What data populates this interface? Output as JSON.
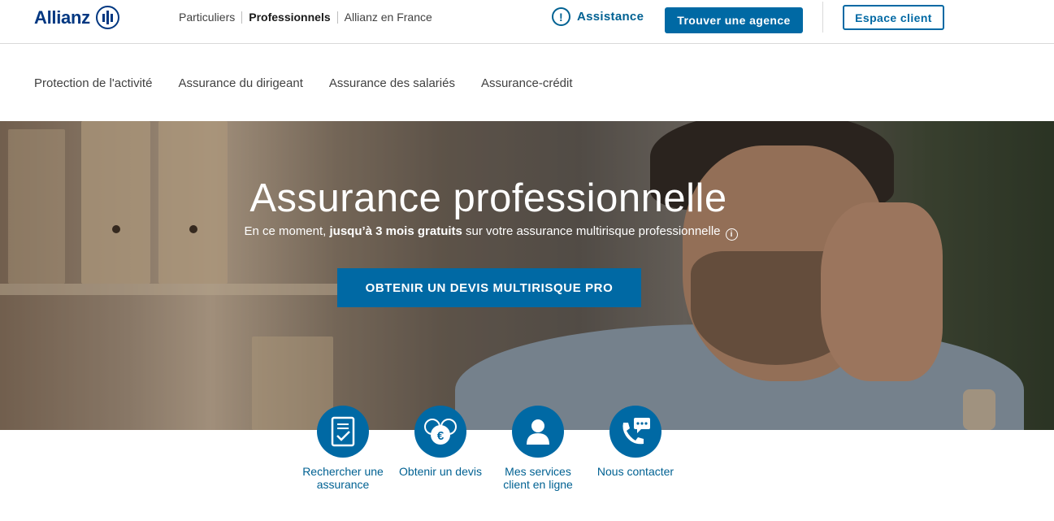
{
  "header": {
    "brand": "Allianz",
    "nav": [
      "Particuliers",
      "Professionnels",
      "Allianz en France"
    ],
    "active_nav": "Professionnels",
    "assistance_label": "Assistance",
    "find_agency_label": "Trouver une agence",
    "client_space_label": "Espace client"
  },
  "subnav": [
    "Protection de l'activité",
    "Assurance du dirigeant",
    "Assurance des salariés",
    "Assurance-crédit"
  ],
  "hero": {
    "title": "Assurance professionnelle",
    "subtitle_prefix": "En ce moment, ",
    "subtitle_bold": "jusqu’à 3 mois gratuits",
    "subtitle_suffix": " sur votre assurance multirisque professionnelle",
    "cta_label": "OBTENIR UN DEVIS MULTIRISQUE PRO"
  },
  "services": [
    {
      "label_line1": "Rechercher une",
      "label_line2": "assurance",
      "icon": "document-check-icon"
    },
    {
      "label_line1": "Obtenir un devis",
      "label_line2": "",
      "icon": "euro-coins-icon"
    },
    {
      "label_line1": "Mes services",
      "label_line2": "client en ligne",
      "icon": "user-icon"
    },
    {
      "label_line1": "Nous contacter",
      "label_line2": "",
      "icon": "phone-chat-icon"
    }
  ],
  "colors": {
    "brand": "#003781",
    "accent": "#0069a4"
  }
}
